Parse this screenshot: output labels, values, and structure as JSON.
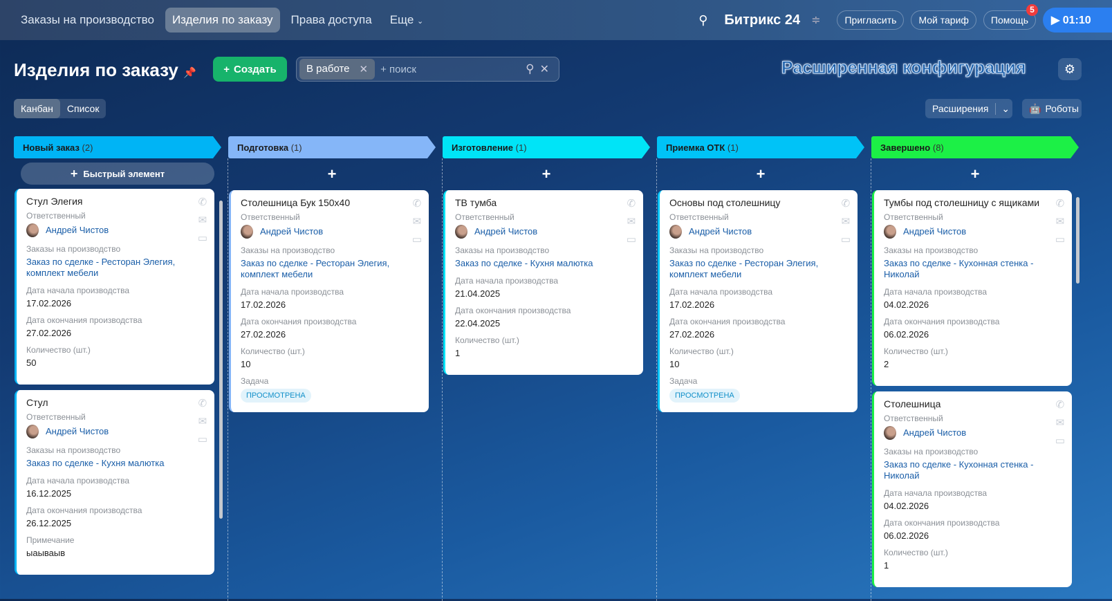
{
  "topbar": {
    "nav": [
      "Заказы на производство",
      "Изделия по заказу",
      "Права доступа",
      "Еще"
    ],
    "logo": "Битрикс 24",
    "buttons": [
      "Пригласить",
      "Мой тариф",
      "Помощь"
    ],
    "help_badge": "5",
    "timer": "01:10"
  },
  "header": {
    "title": "Изделия по заказу",
    "create": "Создать",
    "filter_chip": "В работе",
    "search_placeholder": "+ поиск",
    "config_label": "Расширенная конфигурация",
    "views": [
      "Канбан",
      "Список"
    ],
    "extensions": "Расширения",
    "robots": "Роботы"
  },
  "quick_add": "Быстрый элемент",
  "labels": {
    "resp": "Ответственный",
    "orders": "Заказы на производство",
    "start": "Дата начала производства",
    "end": "Дата окончания производства",
    "qty": "Количество (шт.)",
    "task": "Задача",
    "note": "Примечание"
  },
  "columns": [
    {
      "name": "Новый заказ",
      "count": "(2)",
      "color": "#00b4f5",
      "cards": [
        {
          "title": "Стул Элегия",
          "person": "Андрей Чистов",
          "order": "Заказ по сделке - Ресторан Элегия, комплект мебели",
          "start": "17.02.2026",
          "end": "27.02.2026",
          "qty": "50"
        },
        {
          "title": "Стул",
          "person": "Андрей Чистов",
          "order": "Заказ по сделке - Кухня малютка",
          "start": "16.12.2025",
          "end": "26.12.2025",
          "note": "ыаываыв"
        }
      ]
    },
    {
      "name": "Подготовка",
      "count": "(1)",
      "color": "#85b6f8",
      "cards": [
        {
          "title": "Столешница Бук 150x40",
          "person": "Андрей Чистов",
          "order": "Заказ по сделке - Ресторан Элегия, комплект мебели",
          "start": "17.02.2026",
          "end": "27.02.2026",
          "qty": "10",
          "task": "ПРОСМОТРЕНА"
        }
      ]
    },
    {
      "name": "Изготовление",
      "count": "(1)",
      "color": "#00e4f7",
      "cards": [
        {
          "title": "ТВ тумба",
          "person": "Андрей Чистов",
          "order": "Заказ по сделке - Кухня малютка",
          "start": "21.04.2025",
          "end": "22.04.2025",
          "qty": "1"
        }
      ]
    },
    {
      "name": "Приемка ОТК",
      "count": "(1)",
      "color": "#00c3f7",
      "cards": [
        {
          "title": "Основы под столешницу",
          "person": "Андрей Чистов",
          "order": "Заказ по сделке - Ресторан Элегия, комплект мебели",
          "start": "17.02.2026",
          "end": "27.02.2026",
          "qty": "10",
          "task": "ПРОСМОТРЕНА"
        }
      ]
    },
    {
      "name": "Завершено",
      "count": "(8)",
      "color": "#1cf046",
      "cards": [
        {
          "title": "Тумбы под столешницу с ящиками",
          "person": "Андрей Чистов",
          "order": "Заказ по сделке - Кухонная стенка - Николай",
          "start": "04.02.2026",
          "end": "06.02.2026",
          "qty": "2"
        },
        {
          "title": "Столешница",
          "person": "Андрей Чистов",
          "order": "Заказ по сделке - Кухонная стенка - Николай",
          "start": "04.02.2026",
          "end": "06.02.2026",
          "qty": "1"
        }
      ]
    }
  ]
}
